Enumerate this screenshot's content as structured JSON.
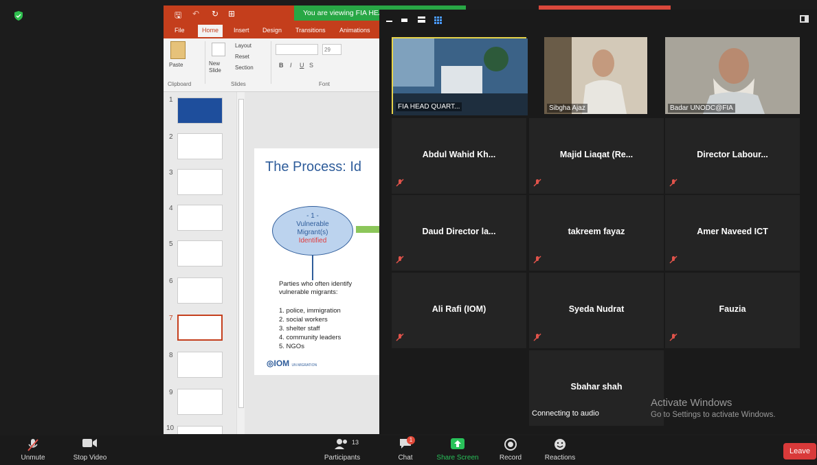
{
  "powerpoint": {
    "tabs": [
      "File",
      "Home",
      "Insert",
      "Design",
      "Transitions",
      "Animations"
    ],
    "ribbon": {
      "paste": "Paste",
      "clipboard": "Clipboard",
      "new_slide": "New Slide",
      "layout": "Layout",
      "reset": "Reset",
      "section": "Section",
      "slides_group": "Slides",
      "font_size": "29",
      "font_group": "Font"
    },
    "slide_numbers": [
      "1",
      "2",
      "3",
      "4",
      "5",
      "6",
      "7",
      "8",
      "9",
      "10"
    ],
    "slide": {
      "title": "The Process: Id",
      "ellipse_num": "- 1 -",
      "ellipse_line1": "Vulnerable",
      "ellipse_line2": "Migrant(s)",
      "ellipse_line3": "Identified",
      "intro": "Parties who often identify vulnerable migrants:",
      "list": [
        "1.  police, immigration",
        "2.  social workers",
        "3.  shelter staff",
        "4.  community leaders",
        "5.  NGOs"
      ],
      "logo": "IOM",
      "logo_sub": "UN MIGRATION"
    }
  },
  "banner": {
    "viewing": "You are viewing FIA HEAD QUARTERS'"
  },
  "participants": [
    {
      "name": "FIA HEAD QUARTERS",
      "type": "video",
      "label": "FIA HEAD QUART..."
    },
    {
      "name": "Sibgha Ajaz",
      "type": "video",
      "label": "Sibgha Ajaz"
    },
    {
      "name": "Badar UNODC@FIA",
      "type": "video",
      "label": "Badar UNODC@FIA"
    },
    {
      "name": "Abdul Wahid Kh...",
      "type": "name"
    },
    {
      "name": "Majid Liaqat (Re...",
      "type": "name"
    },
    {
      "name": "Director Labour...",
      "type": "name"
    },
    {
      "name": "Daud Director la...",
      "type": "name"
    },
    {
      "name": "takreem fayaz",
      "type": "name"
    },
    {
      "name": "Amer Naveed ICT",
      "type": "name"
    },
    {
      "name": "Ali Rafi (IOM)",
      "type": "name"
    },
    {
      "name": "Syeda Nudrat",
      "type": "name"
    },
    {
      "name": "Fauzia",
      "type": "name"
    },
    {
      "name": "Sbahar shah",
      "type": "name",
      "status": "Connecting to audio"
    }
  ],
  "watermark": {
    "line1": "Activate Windows",
    "line2": "Go to Settings to activate Windows."
  },
  "toolbar": {
    "unmute": "Unmute",
    "stop_video": "Stop Video",
    "participants": "Participants",
    "participants_count": "13",
    "chat": "Chat",
    "chat_badge": "1",
    "share_screen": "Share Screen",
    "record": "Record",
    "reactions": "Reactions",
    "leave": "Leave"
  },
  "colors": {
    "ppt_accent": "#c43e1c",
    "zoom_green": "#28a745",
    "leave_red": "#d93a3a"
  }
}
